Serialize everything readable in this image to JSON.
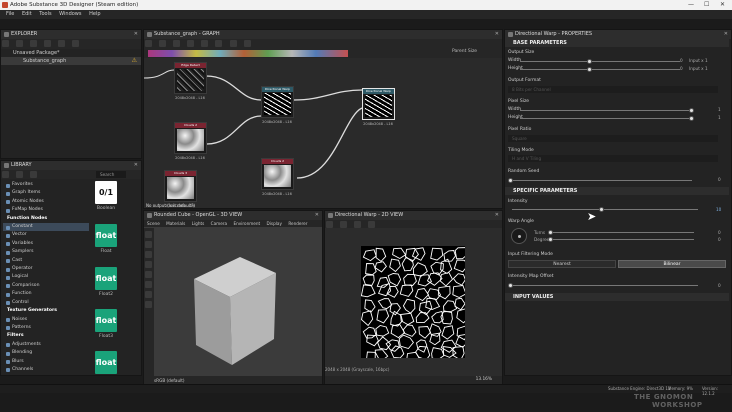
{
  "app": {
    "title": "Adobe Substance 3D Designer (Steam edition)"
  },
  "menu": [
    "File",
    "Edit",
    "Tools",
    "Windows",
    "Help"
  ],
  "explorer": {
    "title": "EXPLORER",
    "package": "Unsaved Package*",
    "graph": "Substance_graph"
  },
  "library": {
    "title": "LIBRARY",
    "search_placeholder": "Search",
    "items": [
      {
        "label": "Favorites",
        "type": "item"
      },
      {
        "label": "Graph Items",
        "type": "item"
      },
      {
        "label": "Atomic Nodes",
        "type": "item"
      },
      {
        "label": "FxMap Nodes",
        "type": "item"
      },
      {
        "label": "Function Nodes",
        "type": "header"
      },
      {
        "label": "Constant",
        "type": "selected"
      },
      {
        "label": "Vector",
        "type": "item"
      },
      {
        "label": "Variables",
        "type": "item"
      },
      {
        "label": "Samplers",
        "type": "item"
      },
      {
        "label": "Cast",
        "type": "item"
      },
      {
        "label": "Operator",
        "type": "item"
      },
      {
        "label": "Logical",
        "type": "item"
      },
      {
        "label": "Comparison",
        "type": "item"
      },
      {
        "label": "Function",
        "type": "item"
      },
      {
        "label": "Control",
        "type": "item"
      },
      {
        "label": "Texture Generators",
        "type": "header"
      },
      {
        "label": "Noises",
        "type": "item"
      },
      {
        "label": "Patterns",
        "type": "item"
      },
      {
        "label": "Filters",
        "type": "header"
      },
      {
        "label": "Adjustments",
        "type": "item"
      },
      {
        "label": "Blending",
        "type": "item"
      },
      {
        "label": "Blurs",
        "type": "item"
      },
      {
        "label": "Channels",
        "type": "item"
      }
    ],
    "thumbs": [
      {
        "glyph": "0/1",
        "label": "Boolean",
        "style": "black"
      },
      {
        "glyph": "float",
        "label": "Float",
        "style": "float"
      },
      {
        "glyph": "float",
        "label": "Float2",
        "style": "float"
      },
      {
        "glyph": "float",
        "label": "Float3",
        "style": "float"
      },
      {
        "glyph": "float",
        "label": "",
        "style": "float"
      }
    ]
  },
  "graph": {
    "title": "Substance_graph - GRAPH",
    "parent_size": "Parent Size",
    "no_output": "No output (Is it default?)",
    "nodes": [
      {
        "name": "Edge Detect",
        "size": "2048x2048 - L16"
      },
      {
        "name": "Directional Warp",
        "size": "2048x2048 - L16"
      },
      {
        "name": "Directional Warp",
        "size": "2048x2048 - L16"
      },
      {
        "name": "Clouds 2",
        "size": "2048x2048 - L16"
      },
      {
        "name": "Clouds 2",
        "size": "2048x2048 - L16"
      },
      {
        "name": "Clouds 3",
        "size": "2048x2048 - L16"
      }
    ]
  },
  "view3d": {
    "title": "Rounded Cube - OpenGL - 3D VIEW",
    "menu": [
      "Scene",
      "Materials",
      "Lights",
      "Camera",
      "Environment",
      "Display",
      "Renderer"
    ],
    "colorspace": "sRGB (default)"
  },
  "view2d": {
    "title": "Directional Warp - 2D VIEW",
    "info": "2048 x 2048 (Grayscale, 16bpc)",
    "zoom": "13.16%"
  },
  "properties": {
    "title": "Directional Warp - PROPERTIES",
    "base_section": "BASE PARAMETERS",
    "output_size": "Output Size",
    "width": "Width",
    "height": "Height",
    "input_x1": "Input x 1",
    "zero": "0",
    "output_format": "Output Format",
    "output_format_value": "8 Bits per Channel",
    "pixel_size": "Pixel Size",
    "one": "1",
    "pixel_ratio": "Pixel Ratio",
    "pixel_ratio_value": "Square",
    "tiling_mode": "Tiling Mode",
    "tiling_mode_value": "H and V Tiling",
    "random_seed": "Random Seed",
    "specific_section": "SPECIFIC PARAMETERS",
    "intensity": "Intensity",
    "intensity_value": "10",
    "warp_angle": "Warp Angle",
    "turns": "Turns",
    "degrees": "Degrees",
    "filtering_mode": "Input Filtering Mode",
    "nearest": "Nearest",
    "bilinear": "Bilinear",
    "map_offset": "Intensity Map Offset",
    "input_values": "INPUT VALUES"
  },
  "status": {
    "engine": "Substance Engine: Direct3D 11",
    "memory": "Memory: 9%",
    "version": "Version: 12.1.2"
  },
  "watermark": {
    "line1": "THE GNOMON",
    "line2": "WORKSHOP"
  }
}
